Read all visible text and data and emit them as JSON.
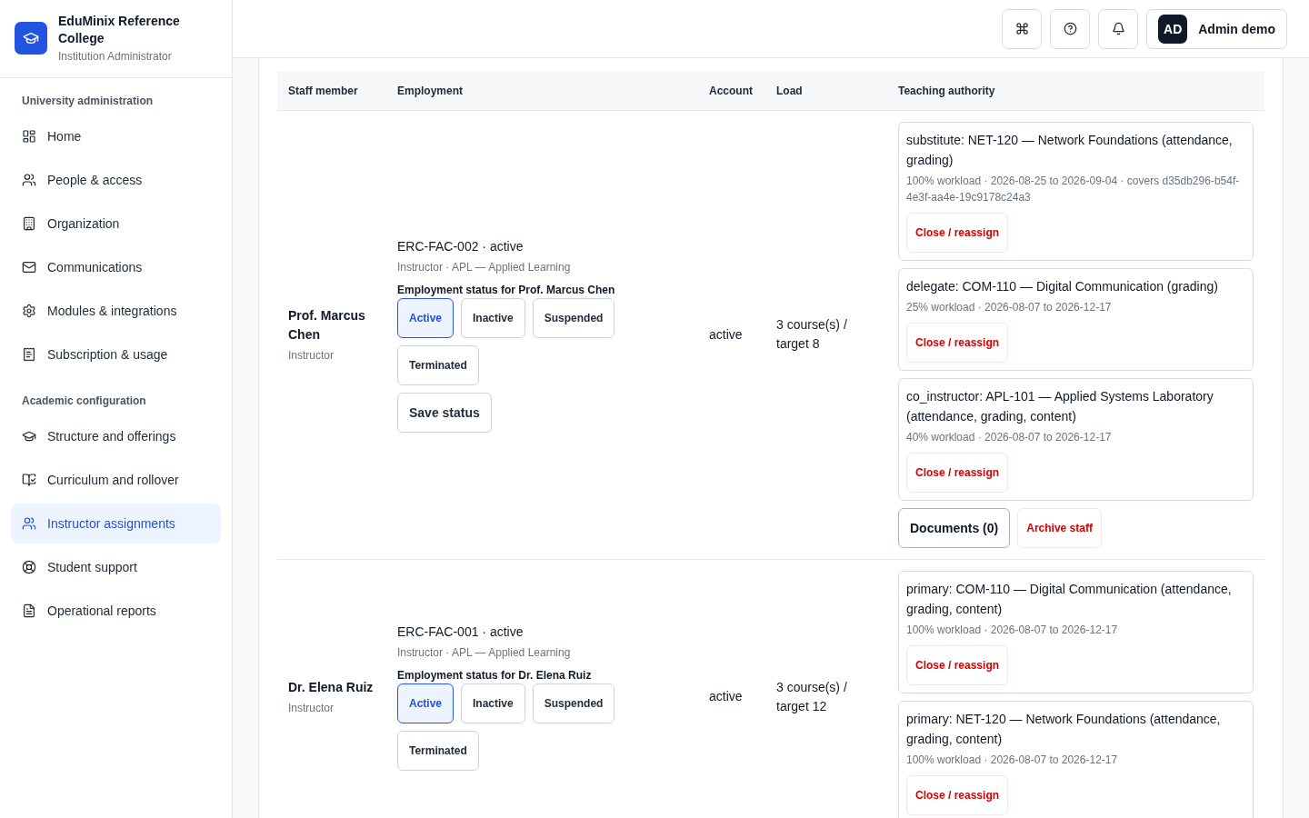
{
  "sidebar": {
    "brand": {
      "name": "EduMinix Reference College",
      "role": "Institution Administrator"
    },
    "sections": [
      {
        "title": "University administration",
        "items": [
          {
            "label": "Home",
            "selected": false
          },
          {
            "label": "People & access",
            "selected": false
          },
          {
            "label": "Organization",
            "selected": false
          },
          {
            "label": "Communications",
            "selected": false
          },
          {
            "label": "Modules & integrations",
            "selected": false
          },
          {
            "label": "Subscription & usage",
            "selected": false
          }
        ]
      },
      {
        "title": "Academic configuration",
        "items": [
          {
            "label": "Structure and offerings",
            "selected": false
          },
          {
            "label": "Curriculum and rollover",
            "selected": false
          },
          {
            "label": "Instructor assignments",
            "selected": true
          },
          {
            "label": "Student support",
            "selected": false
          },
          {
            "label": "Operational reports",
            "selected": false
          }
        ]
      }
    ]
  },
  "topbar": {
    "user": {
      "initials": "AD",
      "name": "Admin demo"
    }
  },
  "table": {
    "columns": [
      "Staff member",
      "Employment",
      "Account",
      "Load",
      "Teaching authority"
    ],
    "rows": [
      {
        "name": "Prof. Marcus Chen",
        "role": "Instructor",
        "employee": "ERC-FAC-002 · active",
        "department": "Instructor · APL — Applied Learning",
        "status_label": "Employment status for Prof. Marcus Chen",
        "statuses": [
          {
            "label": "Active",
            "selected": true
          },
          {
            "label": "Inactive",
            "selected": false
          },
          {
            "label": "Suspended",
            "selected": false
          },
          {
            "label": "Terminated",
            "selected": false
          }
        ],
        "save": "Save status",
        "account": "active",
        "load": "3 course(s) / target 8",
        "assignments": [
          {
            "title": "substitute: NET-120 — Network Foundations (attendance, grading)",
            "meta": "100% workload · 2026-08-25 to 2026-09-04 · covers d35db296-b54f-4e3f-aa4e-19c9178c24a3",
            "action": "Close / reassign"
          },
          {
            "title": "delegate: COM-110 — Digital Communication (grading)",
            "meta": "25% workload · 2026-08-07 to 2026-12-17",
            "action": "Close / reassign"
          },
          {
            "title": "co_instructor: APL-101 — Applied Systems Laboratory (attendance, grading, content)",
            "meta": "40% workload · 2026-08-07 to 2026-12-17",
            "action": "Close / reassign"
          }
        ],
        "actions": [
          {
            "label": "Documents (0)",
            "kind": "default"
          },
          {
            "label": "Archive staff",
            "kind": "danger"
          }
        ]
      },
      {
        "name": "Dr. Elena Ruiz",
        "role": "Instructor",
        "employee": "ERC-FAC-001 · active",
        "department": "Instructor · APL — Applied Learning",
        "status_label": "Employment status for Dr. Elena Ruiz",
        "statuses": [
          {
            "label": "Active",
            "selected": true
          },
          {
            "label": "Inactive",
            "selected": false
          },
          {
            "label": "Suspended",
            "selected": false
          },
          {
            "label": "Terminated",
            "selected": false
          }
        ],
        "account": "active",
        "load": "3 course(s) / target 12",
        "assignments": [
          {
            "title": "primary: COM-110 — Digital Communication (attendance, grading, content)",
            "meta": "100% workload · 2026-08-07 to 2026-12-17",
            "action": "Close / reassign"
          },
          {
            "title": "primary: NET-120 — Network Foundations (attendance, grading, content)",
            "meta": "100% workload · 2026-08-07 to 2026-12-17",
            "action": "Close / reassign"
          }
        ]
      }
    ]
  }
}
